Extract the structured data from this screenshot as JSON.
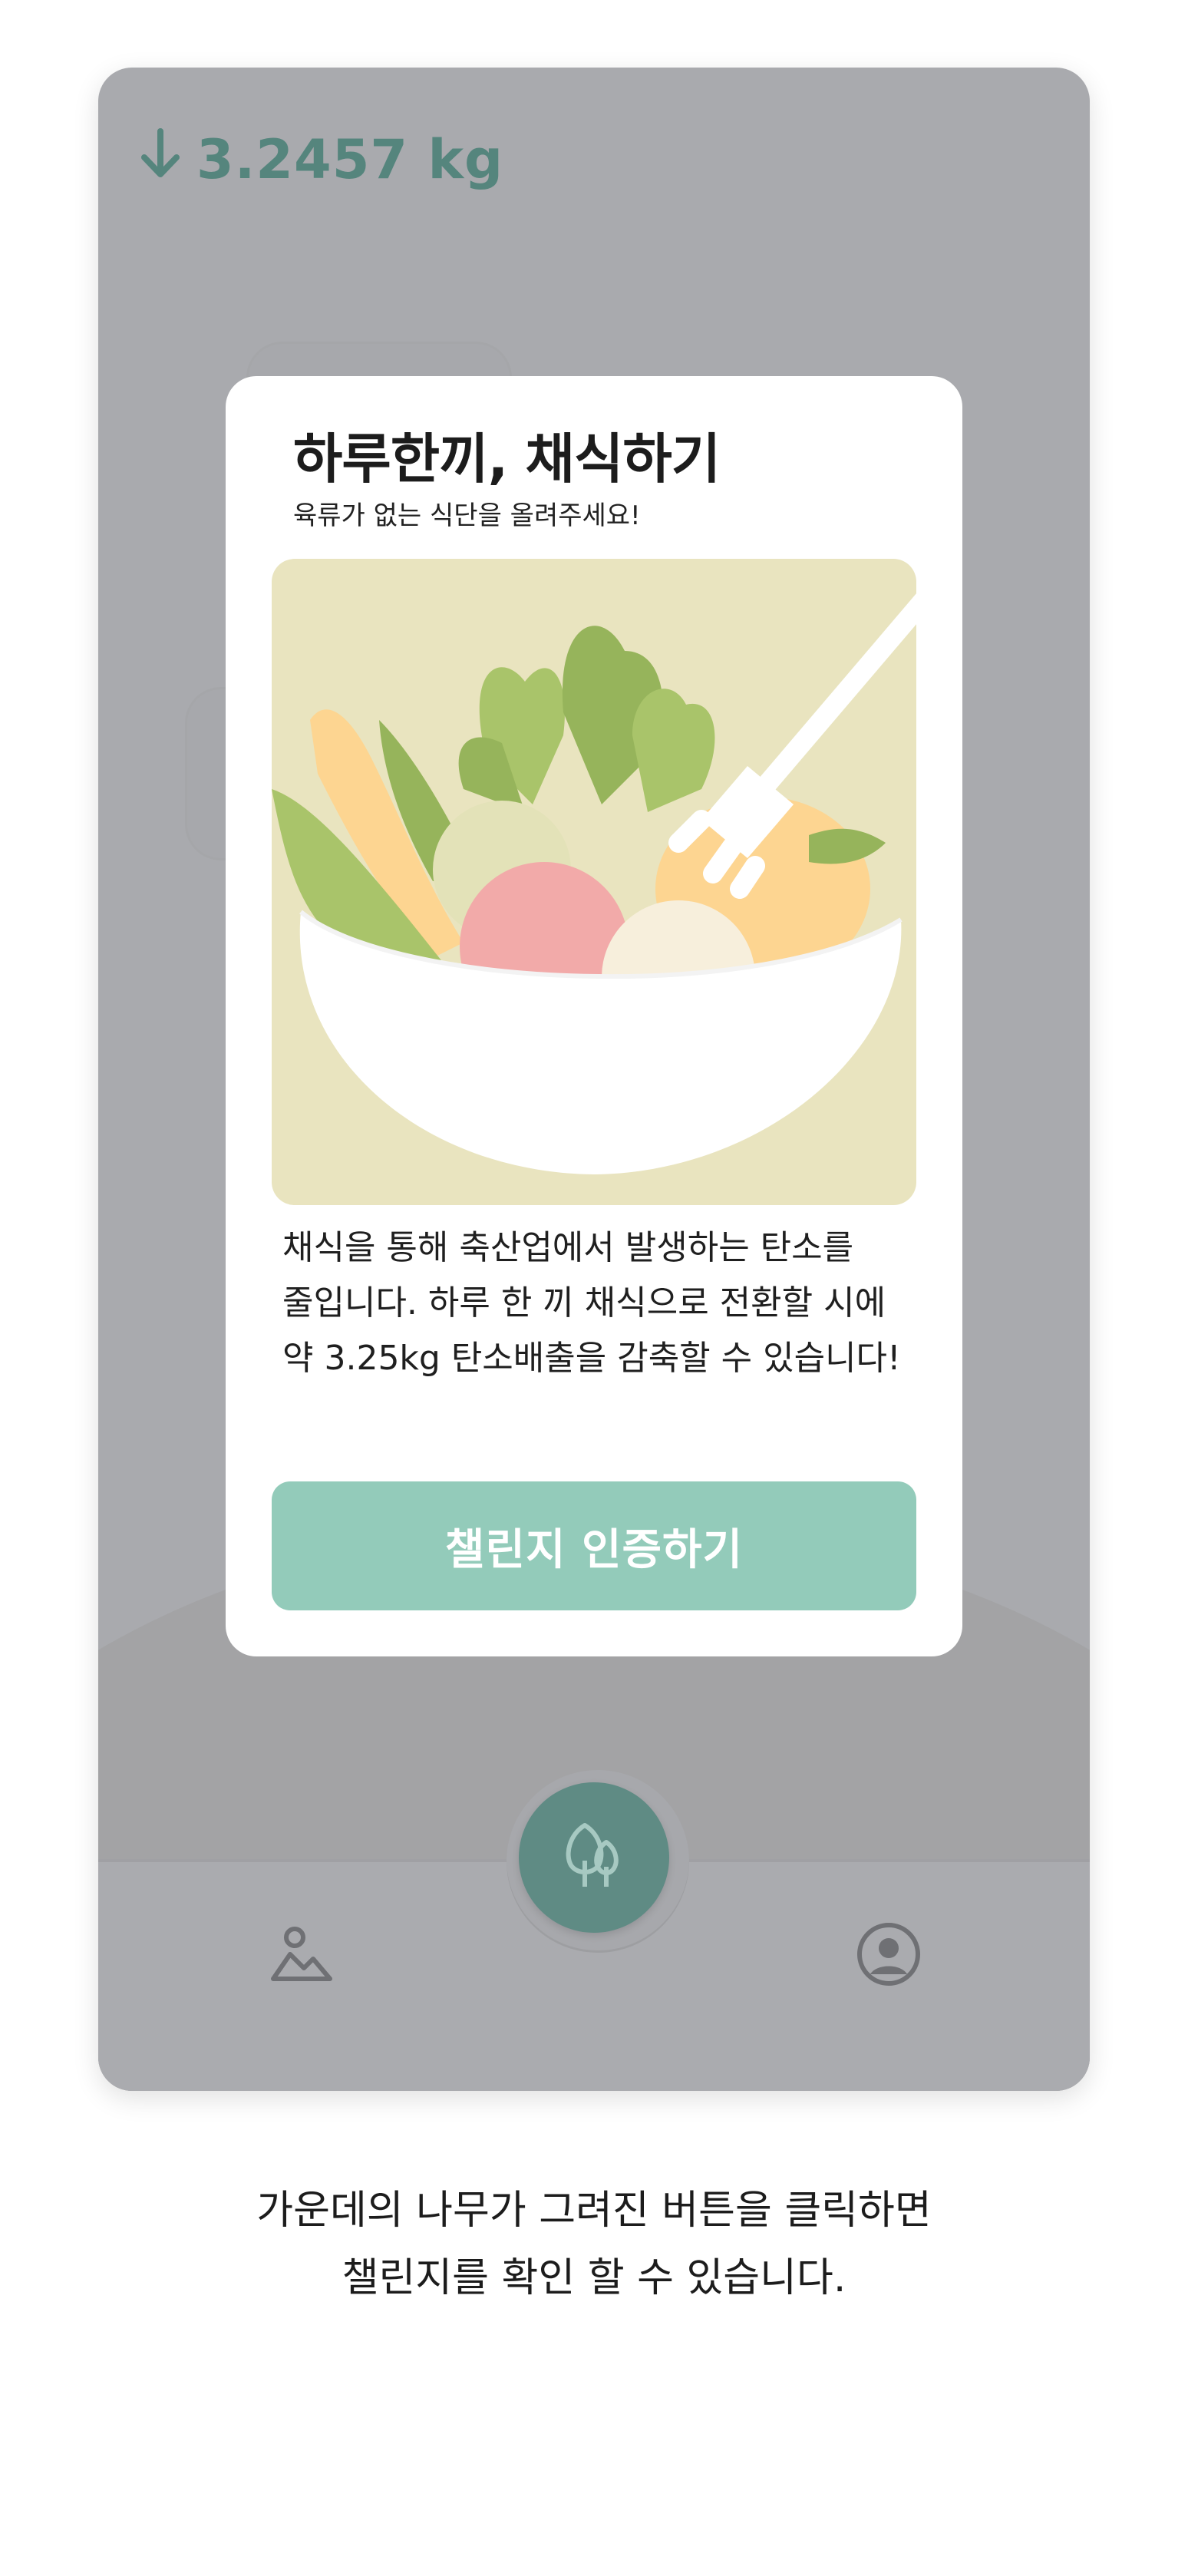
{
  "header": {
    "reduction_value": "3.2457 kg",
    "arrow_icon": "arrow-down-icon"
  },
  "modal": {
    "title": "하루한끼, 채식하기",
    "subtitle": "육류가 없는 식단을 올려주세요!",
    "illustration": "salad-bowl-illustration",
    "description": "채식을 통해 축산업에서 발생하는 탄소를 줄입니다. 하루 한 끼 채식으로 전환할 시에 약 3.25kg 탄소배출을 감축할 수 있습니다!",
    "button_label": "챌린지 인증하기"
  },
  "tabbar": {
    "items": [
      {
        "icon": "gallery-icon"
      },
      {
        "icon": "tree-icon"
      },
      {
        "icon": "profile-icon"
      }
    ]
  },
  "caption": {
    "line1": "가운데의 나무가 그려진 버튼을 클릭하면",
    "line2": "챌린지를 확인 할 수 있습니다."
  },
  "colors": {
    "accent": "#5f8b84",
    "button": "#93cbba",
    "overlay": "#a9aaae",
    "illustration_bg": "#e9e4bf"
  }
}
